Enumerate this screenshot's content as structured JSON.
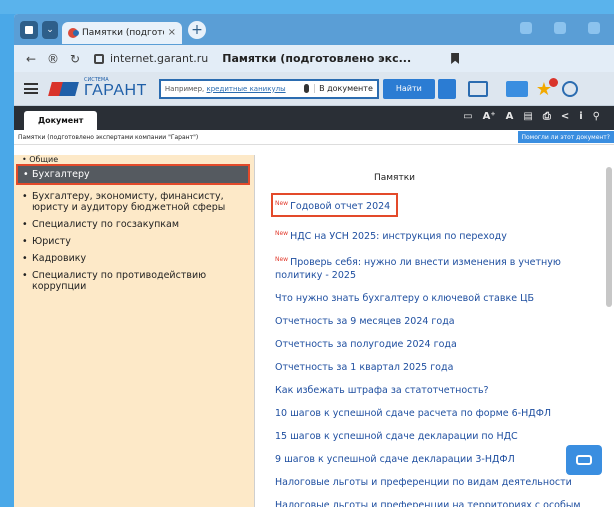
{
  "browser": {
    "tab_title": "Памятки (подготовле",
    "tab_close": "×",
    "new_tab": "+",
    "url": "internet.garant.ru",
    "page_title": "Памятки (подготовлено экс..."
  },
  "toolbar": {
    "logo_small": "СИСТЕМА",
    "logo_big": "ГАРАНТ",
    "search_placeholder_prefix": "Например,",
    "search_placeholder_link": "кредитные каникулы",
    "search_scope": "В документе",
    "find_label": "Найти"
  },
  "doc": {
    "tab_label": "Документ",
    "header": "Памятки (подготовлено экспертами компании \"Гарант\")",
    "help_button": "Помогли ли этот документ?",
    "icons": [
      "A+",
      "A",
      "print",
      "share",
      "info",
      "pin"
    ]
  },
  "sidebar": {
    "cut_item": "• Общие",
    "items": [
      {
        "label": "Бухгалтеру",
        "active": true
      },
      {
        "label": "Бухгалтеру, экономисту, финансисту, юристу и аудитору бюджетной сферы",
        "active": false
      },
      {
        "label": "Специалисту по госзакупкам",
        "active": false
      },
      {
        "label": "Юристу",
        "active": false
      },
      {
        "label": "Кадровику",
        "active": false
      },
      {
        "label": "Специалисту по противодействию коррупции",
        "active": false
      }
    ]
  },
  "main": {
    "title": "Памятки",
    "new_tag": "New",
    "links": [
      {
        "text": "Годовой отчет 2024",
        "is_new": true,
        "highlighted": true
      },
      {
        "text": "НДС на УСН 2025: инструкция по переходу",
        "is_new": true,
        "highlighted": false
      },
      {
        "text": "Проверь себя: нужно ли внести изменения в учетную политику - 2025",
        "is_new": true,
        "highlighted": false
      },
      {
        "text": "Что нужно знать бухгалтеру о ключевой ставке ЦБ",
        "is_new": false,
        "highlighted": false
      },
      {
        "text": "Отчетность за 9 месяцев 2024 года",
        "is_new": false,
        "highlighted": false
      },
      {
        "text": "Отчетность за полугодие 2024 года",
        "is_new": false,
        "highlighted": false
      },
      {
        "text": "Отчетность за 1 квартал 2025 года",
        "is_new": false,
        "highlighted": false
      },
      {
        "text": "Как избежать штрафа за статотчетность?",
        "is_new": false,
        "highlighted": false
      },
      {
        "text": "10 шагов к успешной сдаче расчета по форме 6-НДФЛ",
        "is_new": false,
        "highlighted": false
      },
      {
        "text": "15 шагов к успешной сдаче декларации по НДС",
        "is_new": false,
        "highlighted": false
      },
      {
        "text": "9 шагов к успешной сдаче декларации 3-НДФЛ",
        "is_new": false,
        "highlighted": false
      },
      {
        "text": "Налоговые льготы и преференции по видам деятельности",
        "is_new": false,
        "highlighted": false
      },
      {
        "text": "Налоговые льготы и преференции на территориях с особым",
        "is_new": false,
        "highlighted": false
      }
    ]
  },
  "colors": {
    "accent": "#2b7cd3",
    "highlight_border": "#e34a2a",
    "sidebar_bg": "#fde9c8",
    "link": "#1f4fa0"
  }
}
